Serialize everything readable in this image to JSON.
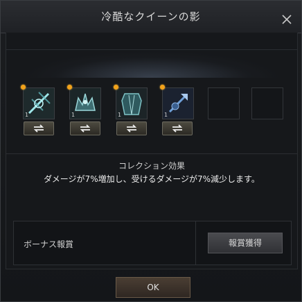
{
  "window": {
    "title": "冷酷なクイーンの影"
  },
  "slots": [
    {
      "level": "1",
      "icon": "sword-item-icon"
    },
    {
      "level": "1",
      "icon": "crown-item-icon"
    },
    {
      "level": "1",
      "icon": "armor-item-icon"
    },
    {
      "level": "1",
      "icon": "spear-item-icon"
    }
  ],
  "collection": {
    "title": "コレクション効果",
    "description": "ダメージが7%増加し、受けるダメージが7%減少します。"
  },
  "bonus": {
    "label": "ボーナス報賞",
    "claim_label": "報賞獲得"
  },
  "footer": {
    "ok_label": "OK"
  },
  "colors": {
    "dot": "#f2a21a",
    "ok_button": "#3d332b"
  }
}
